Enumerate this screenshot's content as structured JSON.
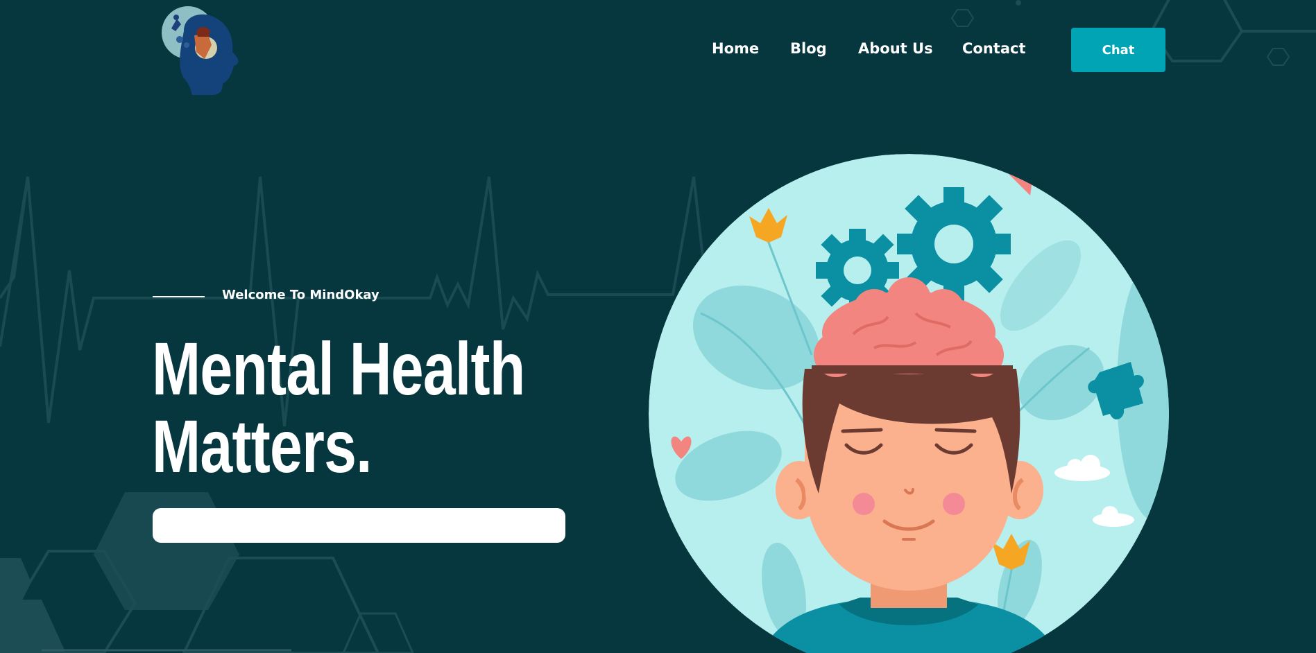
{
  "brand": {
    "logo_icon": "head-with-brain-logo"
  },
  "nav": {
    "items": [
      {
        "label": "Home"
      },
      {
        "label": "Blog"
      },
      {
        "label": "About Us"
      },
      {
        "label": "Contact"
      }
    ],
    "chat_label": "Chat"
  },
  "hero": {
    "eyebrow": "Welcome To MindOkay",
    "title_line1": "Mental Health",
    "title_line2": "Matters.",
    "input_value": ""
  },
  "colors": {
    "background": "#06363e",
    "accent": "#00a4b4",
    "illustration_bg": "#b7eeee",
    "gear": "#0a8fa3",
    "brain": "#f2857f",
    "hair": "#6b3b32",
    "skin": "#fbb08e"
  }
}
